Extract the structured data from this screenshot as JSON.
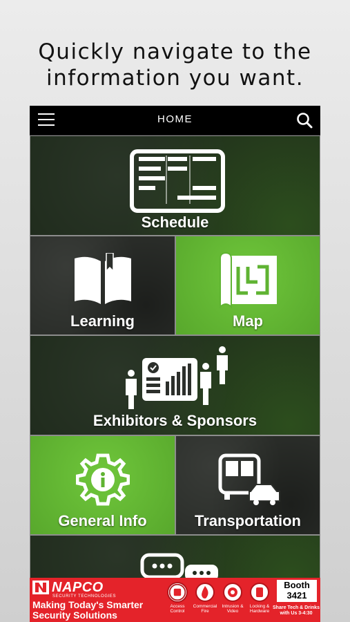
{
  "caption": {
    "line1": "Quickly navigate to the",
    "line2": "information you want."
  },
  "navbar": {
    "title": "HOME",
    "menu_icon": "hamburger-menu-icon",
    "search_icon": "search-icon"
  },
  "tiles": {
    "schedule": {
      "label": "Schedule",
      "icon": "schedule-board-icon"
    },
    "learning": {
      "label": "Learning",
      "icon": "open-book-icon"
    },
    "map": {
      "label": "Map",
      "icon": "floor-map-icon"
    },
    "exhibitors": {
      "label": "Exhibitors & Sponsors",
      "icon": "exhibitors-presentation-icon"
    },
    "general_info": {
      "label": "General Info",
      "icon": "info-gear-icon"
    },
    "transportation": {
      "label": "Transportation",
      "icon": "bus-car-icon"
    },
    "next": {
      "label": "",
      "icon": "chat-bubbles-icon"
    }
  },
  "banner": {
    "brand": "NAPCO",
    "brand_sub": "SECURITY TECHNOLOGIES",
    "tagline1": "Making Today's Smarter",
    "tagline2": "Security Solutions",
    "categories": [
      {
        "label": "Access Control"
      },
      {
        "label": "Commercial Fire"
      },
      {
        "label": "Intrusion & Video"
      },
      {
        "label": "Locking & Hardware"
      }
    ],
    "booth_label": "Booth",
    "booth_number": "3421",
    "share_text": "Share Tech & Drinks with Us 3-4:30",
    "colors": {
      "background": "#e4232a",
      "accent_green": "#5fb332"
    }
  }
}
